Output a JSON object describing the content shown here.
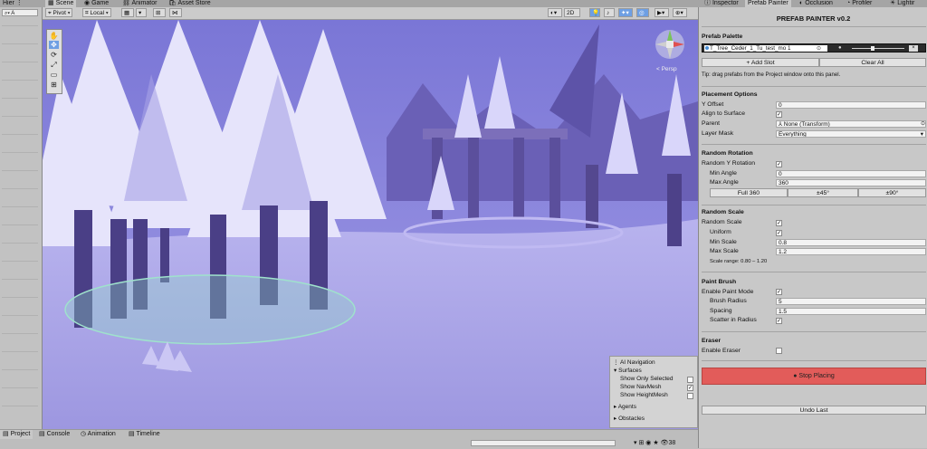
{
  "top_tabs": {
    "hierarchy": "Hier",
    "scene": "Scene",
    "game": "Game",
    "animator": "Animator",
    "asset_store": "Asset Store",
    "inspector": "Inspector",
    "prefab_painter": "Prefab Painter",
    "occlusion": "Occlusion",
    "profiler": "Profiler",
    "lighting": "Lightir"
  },
  "hierarchy": {
    "search_text": "A"
  },
  "scene_toolbar": {
    "pivot": "Pivot",
    "local": "Local",
    "mode_2d": "2D"
  },
  "gizmo": {
    "persp_label": "< Persp"
  },
  "overlay": {
    "title": "AI Navigation",
    "surfaces": "Surfaces",
    "show_only_selected": "Show Only Selected",
    "show_only_selected_checked": false,
    "show_navmesh": "Show NavMesh",
    "show_navmesh_checked": true,
    "show_heightmesh": "Show HeightMesh",
    "show_heightmesh_checked": false,
    "agents": "Agents",
    "obstacles": "Obstacles"
  },
  "bottom_tabs": {
    "project": "Project",
    "console": "Console",
    "animation": "Animation",
    "timeline": "Timeline",
    "count": "38"
  },
  "panel": {
    "title": "PREFAB PAINTER  v0.2",
    "palette_header": "Prefab Palette",
    "palette_slot": "T_Tree_Ceder_1_Tu_test_mo 1",
    "add_slot": "+ Add Slot",
    "clear_all": "Clear All",
    "tip": "Tip: drag prefabs from the Project window onto this panel.",
    "placement": {
      "header": "Placement Options",
      "y_offset_label": "Y Offset",
      "y_offset": "0",
      "align_label": "Align to Surface",
      "align_checked": true,
      "parent_label": "Parent",
      "parent": "None (Transform)",
      "layer_mask_label": "Layer Mask",
      "layer_mask": "Everything"
    },
    "rotation": {
      "header": "Random Rotation",
      "random_y_label": "Random Y Rotation",
      "random_y_checked": true,
      "min_label": "Min Angle",
      "min": "0",
      "max_label": "Max Angle",
      "max": "360",
      "full": "Full 360",
      "pm45": "±45°",
      "pm90": "±90°"
    },
    "scale": {
      "header": "Random Scale",
      "random_label": "Random Scale",
      "random_checked": true,
      "uniform_label": "Uniform",
      "uniform_checked": true,
      "min_label": "Min Scale",
      "min": "0.8",
      "max_label": "Max Scale",
      "max": "1.2",
      "range_text": "Scale range:  0.80 – 1.20"
    },
    "brush": {
      "header": "Paint Brush",
      "enable_label": "Enable Paint Mode",
      "enable_checked": true,
      "radius_label": "Brush Radius",
      "radius": "5",
      "spacing_label": "Spacing",
      "spacing": "1.5",
      "scatter_label": "Scatter in Radius",
      "scatter_checked": true
    },
    "eraser": {
      "header": "Eraser",
      "enable_label": "Enable Eraser",
      "enable_checked": false
    },
    "stop_placing": "● Stop Placing",
    "undo_last": "Undo Last"
  },
  "colors": {
    "stop_button": "#e25c5a",
    "active_toggle": "#6e9fe3",
    "scene_tint": "#8d86d8"
  }
}
